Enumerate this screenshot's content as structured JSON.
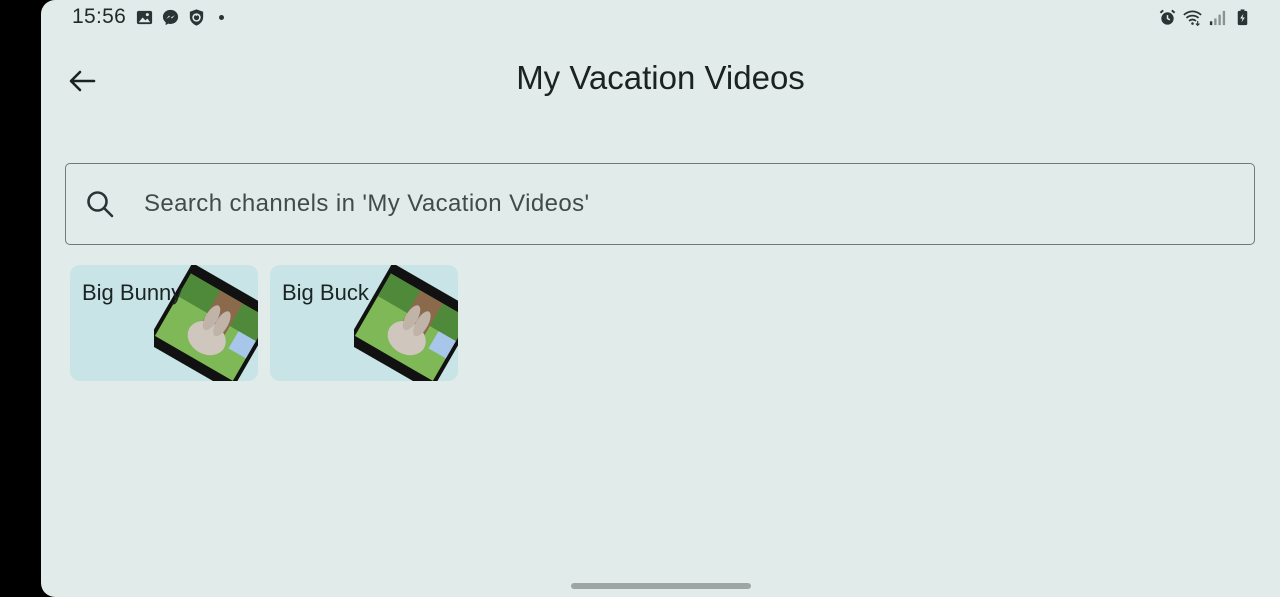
{
  "status_bar": {
    "time": "15:56",
    "left_icons": [
      "image-icon",
      "messenger-icon",
      "shield-icon",
      "notification-dot"
    ],
    "right_icons": [
      "alarm-icon",
      "wifi-icon",
      "signal-icon",
      "battery-icon"
    ]
  },
  "app_bar": {
    "back_icon": "arrow-left-icon",
    "title": "My Vacation Videos"
  },
  "search": {
    "placeholder": "Search channels in 'My Vacation Videos'",
    "value": "",
    "icon": "search-icon"
  },
  "channels": [
    {
      "name": "Big Bunny",
      "thumbnail": "video-thumbnail"
    },
    {
      "name": "Big Buck",
      "thumbnail": "video-thumbnail"
    }
  ],
  "colors": {
    "background": "#e1ecea",
    "card": "#c8e4e6",
    "text": "#1a2222",
    "outline": "#6f7a79"
  }
}
